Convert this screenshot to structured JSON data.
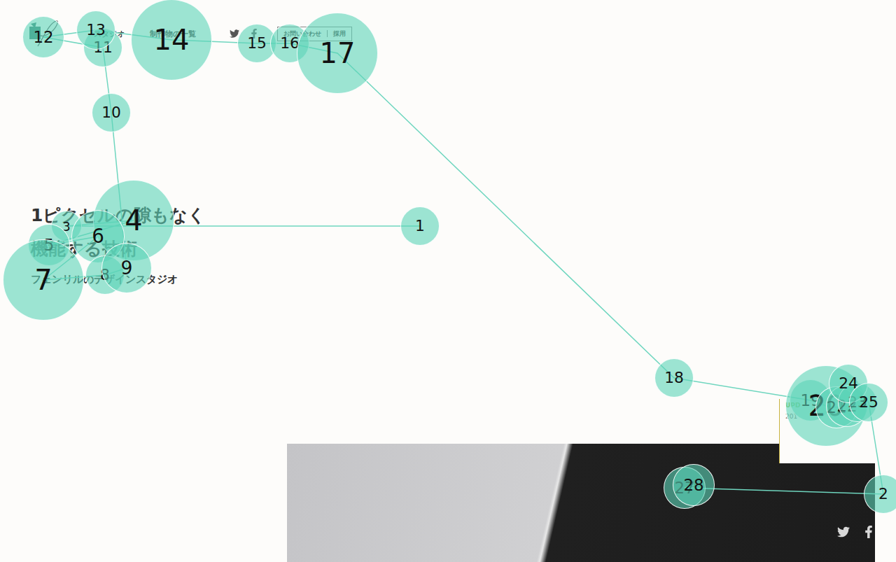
{
  "header": {
    "nav": [
      {
        "label": "スタジオ"
      },
      {
        "label": "制作物の一覧"
      }
    ],
    "buttons": [
      "お問い合わせ",
      "採用"
    ]
  },
  "hero": {
    "title_lines": [
      "1ピクセルの隙もなく",
      "機能する技術"
    ],
    "subtitle": "フェンリルのデザインスタジオ"
  },
  "news_card": {
    "tag": "UPD",
    "date": "201"
  },
  "gaze_points": [
    {
      "label": "1",
      "level": 0.17
    },
    {
      "label": "3",
      "level": 0
    },
    {
      "label": "4",
      "level": 1
    },
    {
      "label": "5",
      "level": 0.22
    },
    {
      "label": "6",
      "level": 0.44
    },
    {
      "label": "7",
      "level": 1
    },
    {
      "label": "8",
      "level": 0.17
    },
    {
      "label": "9",
      "level": 0.39
    },
    {
      "label": "10",
      "level": 0.17
    },
    {
      "label": "11",
      "level": 0.17
    },
    {
      "label": "12",
      "level": 0.22
    },
    {
      "label": "13",
      "level": 0.17
    },
    {
      "label": "14",
      "level": 1
    },
    {
      "label": "15",
      "level": 0.17
    },
    {
      "label": "16",
      "level": 0.17
    },
    {
      "label": "17",
      "level": 1
    },
    {
      "label": "18",
      "level": 0.17
    },
    {
      "label": "19",
      "level": 0.22
    },
    {
      "label": "20",
      "level": 1
    },
    {
      "label": "21",
      "level": 0.22
    },
    {
      "label": "22",
      "level": 0.22
    },
    {
      "label": "23",
      "level": 0.17
    },
    {
      "label": "24",
      "level": 0.17
    },
    {
      "label": "25",
      "level": 0.17
    },
    {
      "label": "2",
      "level": 0.17
    },
    {
      "label": "27",
      "level": 0.22
    },
    {
      "label": "28",
      "level": 0.22
    }
  ]
}
